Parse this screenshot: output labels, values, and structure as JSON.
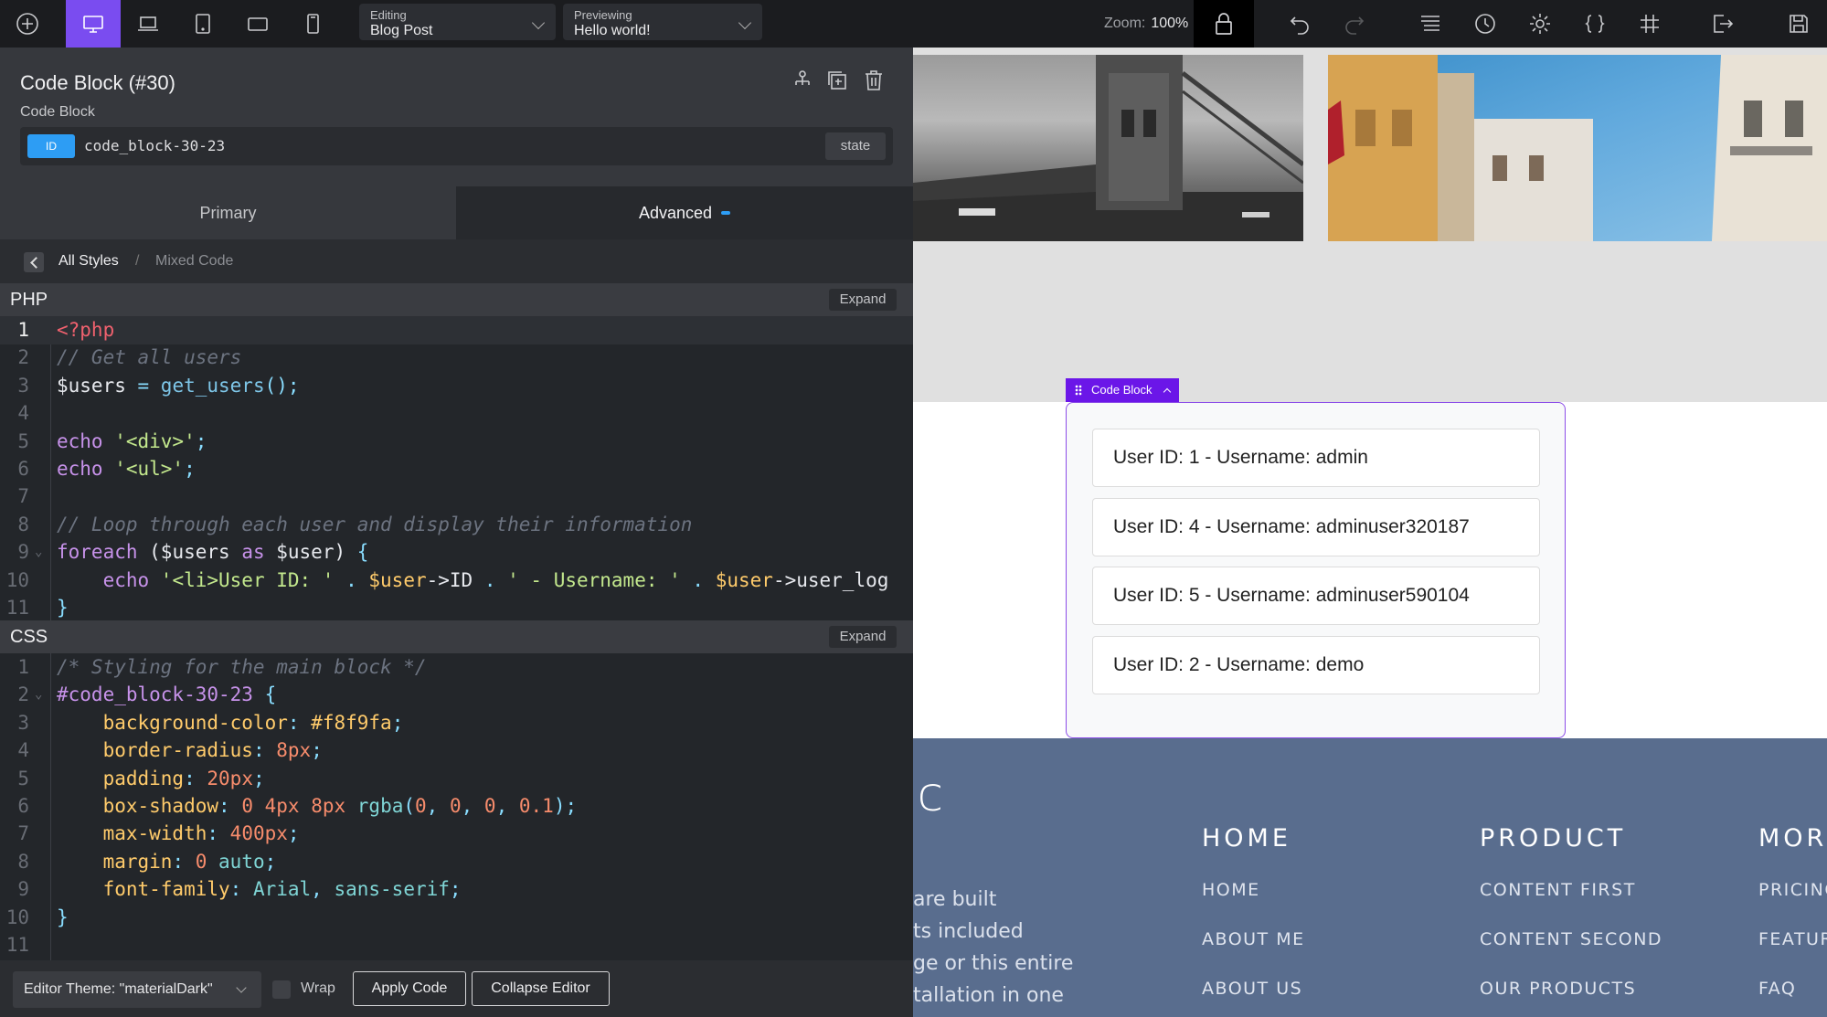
{
  "toolbar": {
    "editing_caption": "Editing",
    "editing_value": "Blog Post",
    "previewing_caption": "Previewing",
    "previewing_value": "Hello world!",
    "zoom_label": "Zoom:",
    "zoom_value": "100%",
    "icons": [
      "add-icon",
      "desktop-icon",
      "laptop-icon",
      "tablet-icon",
      "tablet-landscape-icon",
      "phone-icon",
      "lock-icon",
      "undo-icon",
      "redo-icon",
      "structure-icon",
      "history-icon",
      "settings-icon",
      "code-braces-icon",
      "grid-icon",
      "exit-icon",
      "save-icon"
    ],
    "accent": "#7a4cf0"
  },
  "panel": {
    "title": "Code Block (#30)",
    "subtitle": "Code Block",
    "id_badge": "ID",
    "id_value": "code_block-30-23",
    "state_label": "state",
    "tabs": {
      "primary": "Primary",
      "advanced": "Advanced"
    },
    "breadcrumb": {
      "all": "All Styles",
      "sep": "/",
      "current": "Mixed Code"
    }
  },
  "php": {
    "title": "PHP",
    "expand": "Expand",
    "lines": [
      {
        "n": "1",
        "fold": "",
        "parts": [
          [
            "t-tag",
            "<?php"
          ]
        ]
      },
      {
        "n": "2",
        "fold": "",
        "parts": [
          [
            "t-com",
            "// Get all users"
          ]
        ]
      },
      {
        "n": "3",
        "fold": "",
        "parts": [
          [
            "t-var",
            "$users"
          ],
          [
            "t-op",
            " = "
          ],
          [
            "t-fn",
            "get_users"
          ],
          [
            "t-pun",
            "();"
          ]
        ]
      },
      {
        "n": "4",
        "fold": "",
        "parts": []
      },
      {
        "n": "5",
        "fold": "",
        "parts": [
          [
            "t-kw",
            "echo "
          ],
          [
            "t-str",
            "'<div>'"
          ],
          [
            "t-pun",
            ";"
          ]
        ]
      },
      {
        "n": "6",
        "fold": "",
        "parts": [
          [
            "t-kw",
            "echo "
          ],
          [
            "t-str",
            "'<ul>'"
          ],
          [
            "t-pun",
            ";"
          ]
        ]
      },
      {
        "n": "7",
        "fold": "",
        "parts": []
      },
      {
        "n": "8",
        "fold": "",
        "parts": [
          [
            "t-com",
            "// Loop through each user and display their information"
          ]
        ]
      },
      {
        "n": "9",
        "fold": "⌄",
        "parts": [
          [
            "t-kw",
            "foreach "
          ],
          [
            "t-var",
            "($users "
          ],
          [
            "t-kw",
            "as "
          ],
          [
            "t-var",
            "$user) "
          ],
          [
            "t-pun",
            "{"
          ]
        ]
      },
      {
        "n": "10",
        "fold": "",
        "parts": [
          [
            "t-kw",
            "    echo "
          ],
          [
            "t-str",
            "'<li>User ID: ' "
          ],
          [
            "t-op",
            ". "
          ],
          [
            "t-prop",
            "$user"
          ],
          [
            "t-var",
            "->ID "
          ],
          [
            "t-op",
            ". "
          ],
          [
            "t-str",
            "' - Username: ' "
          ],
          [
            "t-op",
            ". "
          ],
          [
            "t-prop",
            "$user"
          ],
          [
            "t-var",
            "->user_log"
          ]
        ]
      },
      {
        "n": "11",
        "fold": "",
        "parts": [
          [
            "t-pun",
            "}"
          ]
        ]
      }
    ]
  },
  "css": {
    "title": "CSS",
    "expand": "Expand",
    "lines": [
      {
        "n": "1",
        "fold": "",
        "parts": [
          [
            "t-com",
            "/* Styling for the main block */"
          ]
        ]
      },
      {
        "n": "2",
        "fold": "⌄",
        "parts": [
          [
            "t-sel",
            "#code_block-30-23 "
          ],
          [
            "t-pun",
            "{"
          ]
        ]
      },
      {
        "n": "3",
        "fold": "",
        "parts": [
          [
            "t-prop",
            "    background-color"
          ],
          [
            "t-pun",
            ": "
          ],
          [
            "t-prop",
            "#f8f9fa"
          ],
          [
            "t-pun",
            ";"
          ]
        ]
      },
      {
        "n": "4",
        "fold": "",
        "parts": [
          [
            "t-prop",
            "    border-radius"
          ],
          [
            "t-pun",
            ": "
          ],
          [
            "t-num",
            "8"
          ],
          [
            "t-num",
            "px"
          ],
          [
            "t-pun",
            ";"
          ]
        ]
      },
      {
        "n": "5",
        "fold": "",
        "parts": [
          [
            "t-prop",
            "    padding"
          ],
          [
            "t-pun",
            ": "
          ],
          [
            "t-num",
            "20"
          ],
          [
            "t-num",
            "px"
          ],
          [
            "t-pun",
            ";"
          ]
        ]
      },
      {
        "n": "6",
        "fold": "",
        "parts": [
          [
            "t-prop",
            "    box-shadow"
          ],
          [
            "t-pun",
            ": "
          ],
          [
            "t-num",
            "0 4"
          ],
          [
            "t-num",
            "px "
          ],
          [
            "t-num",
            "8"
          ],
          [
            "t-num",
            "px "
          ],
          [
            "t-val",
            "rgba"
          ],
          [
            "t-pun",
            "("
          ],
          [
            "t-num",
            "0"
          ],
          [
            "t-pun",
            ", "
          ],
          [
            "t-num",
            "0"
          ],
          [
            "t-pun",
            ", "
          ],
          [
            "t-num",
            "0"
          ],
          [
            "t-pun",
            ", "
          ],
          [
            "t-num",
            "0.1"
          ],
          [
            "t-pun",
            ");"
          ]
        ]
      },
      {
        "n": "7",
        "fold": "",
        "parts": [
          [
            "t-prop",
            "    max-width"
          ],
          [
            "t-pun",
            ": "
          ],
          [
            "t-num",
            "400"
          ],
          [
            "t-num",
            "px"
          ],
          [
            "t-pun",
            ";"
          ]
        ]
      },
      {
        "n": "8",
        "fold": "",
        "parts": [
          [
            "t-prop",
            "    margin"
          ],
          [
            "t-pun",
            ": "
          ],
          [
            "t-num",
            "0 "
          ],
          [
            "t-val",
            "auto"
          ],
          [
            "t-pun",
            ";"
          ]
        ]
      },
      {
        "n": "9",
        "fold": "",
        "parts": [
          [
            "t-prop",
            "    font-family"
          ],
          [
            "t-pun",
            ": "
          ],
          [
            "t-val",
            "Arial"
          ],
          [
            "t-pun",
            ", "
          ],
          [
            "t-val",
            "sans-serif"
          ],
          [
            "t-pun",
            ";"
          ]
        ]
      },
      {
        "n": "10",
        "fold": "",
        "parts": [
          [
            "t-pun",
            "}"
          ]
        ]
      },
      {
        "n": "11",
        "fold": "",
        "parts": []
      }
    ]
  },
  "bottom": {
    "theme": "Editor Theme: \"materialDark\"",
    "wrap": "Wrap",
    "apply": "Apply Code",
    "collapse": "Collapse Editor"
  },
  "preview": {
    "block_label": "Code Block",
    "users": [
      "User ID: 1 - Username: admin",
      "User ID: 4 - Username: adminuser320187",
      "User ID: 5 - Username: adminuser590104",
      "User ID: 2 - Username: demo"
    ],
    "footer": {
      "brand": "ic",
      "text_lines": [
        "are built",
        "ts included",
        "ge or this entire",
        "tallation in one"
      ],
      "columns": [
        {
          "heading": "HOME",
          "links": [
            "HOME",
            "ABOUT ME",
            "ABOUT US"
          ]
        },
        {
          "heading": "PRODUCT",
          "links": [
            "CONTENT FIRST",
            "CONTENT SECOND",
            "OUR PRODUCTS"
          ]
        },
        {
          "heading": "MOR",
          "links": [
            "PRICING",
            "FEATUR",
            "FAQ"
          ]
        }
      ],
      "bg": "#596d8e"
    }
  }
}
